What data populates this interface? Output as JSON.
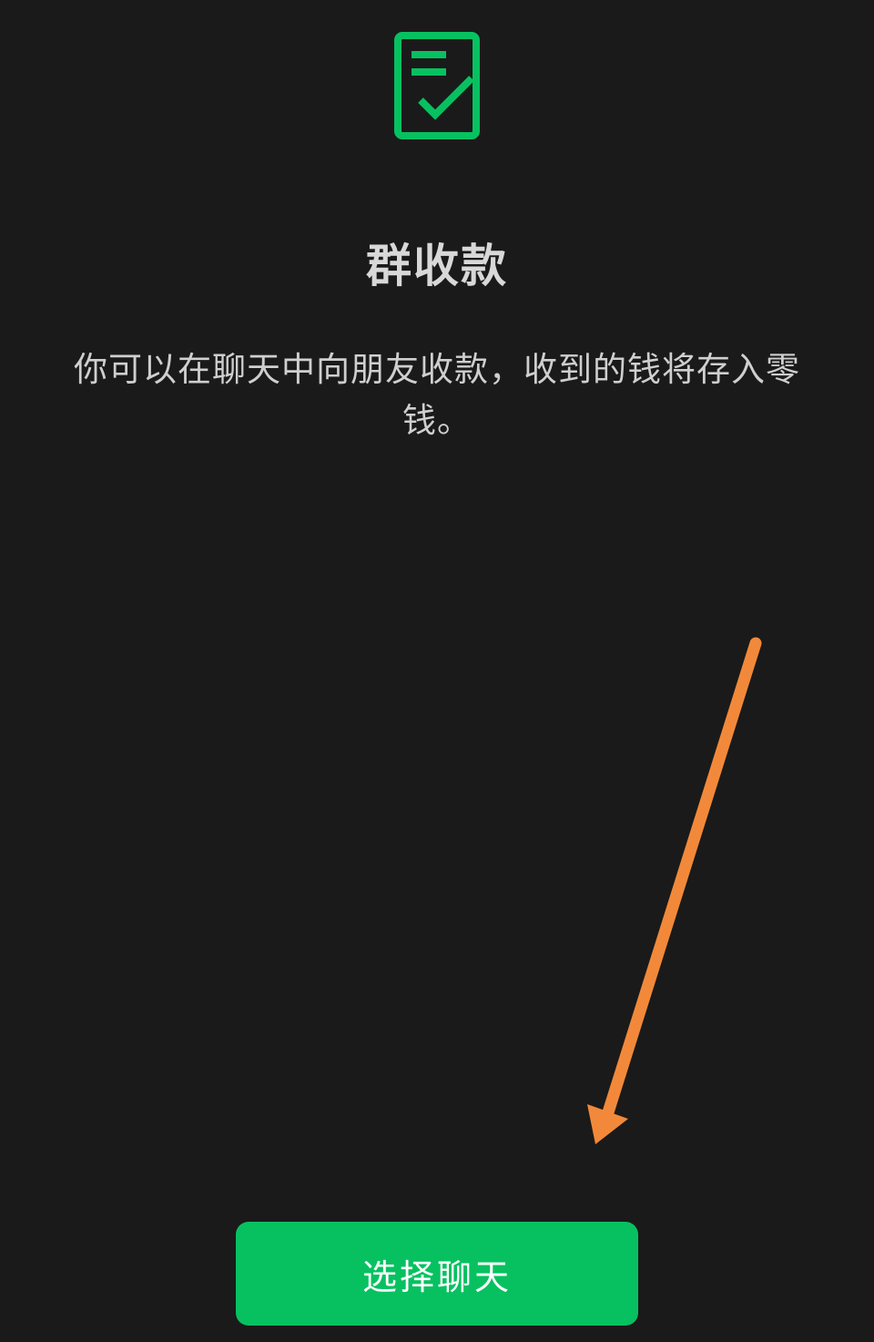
{
  "colors": {
    "background": "#1a1a1a",
    "accent": "#07c160",
    "annotation_arrow": "#f2893a",
    "title_text": "#d8d8d8",
    "body_text": "#cfcfcf"
  },
  "header": {
    "icon": "document-check-icon",
    "title": "群收款"
  },
  "main": {
    "description": "你可以在聊天中向朋友收款，收到的钱将存入零钱。"
  },
  "annotation": {
    "icon": "arrow-down-left-icon"
  },
  "footer": {
    "select_chat_label": "选择聊天"
  }
}
